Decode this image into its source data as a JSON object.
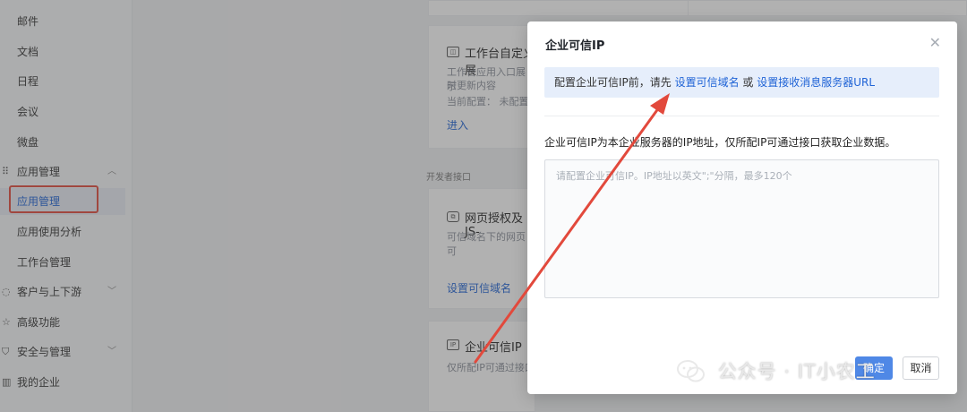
{
  "sidebar": {
    "items": [
      {
        "label": "邮件"
      },
      {
        "label": "文档"
      },
      {
        "label": "日程"
      },
      {
        "label": "会议"
      },
      {
        "label": "微盘"
      },
      {
        "label": "应用管理",
        "group": true,
        "icon": "grid-icon",
        "chevron": "up"
      },
      {
        "label": "应用管理",
        "active": true
      },
      {
        "label": "应用使用分析"
      },
      {
        "label": "工作台管理"
      },
      {
        "label": "客户与上下游",
        "group": true,
        "icon": "chat-icon",
        "chevron": "down"
      },
      {
        "label": "高级功能",
        "group": true,
        "icon": "star-icon"
      },
      {
        "label": "安全与管理",
        "group": true,
        "icon": "shield-icon",
        "chevron": "down"
      },
      {
        "label": "我的企业",
        "group": true,
        "icon": "building-icon"
      }
    ]
  },
  "background": {
    "card_workbench": {
      "title": "工作台自定义展",
      "desc_line1": "工作台应用入口展示",
      "desc_line2": "时更新内容",
      "config": "当前配置：  未配置",
      "link": "进入"
    },
    "section_label": "开发者接口",
    "card_web_auth": {
      "title": "网页授权及JS-",
      "desc": "可信域名下的网页可",
      "link": "设置可信域名"
    },
    "card_trusted_ip": {
      "icon_text": "IP",
      "title": "企业可信IP",
      "desc": "仅所配IP可通过接口"
    }
  },
  "modal": {
    "title": "企业可信IP",
    "close_icon": "close-icon",
    "notice_prefix": "配置企业可信IP前，请先 ",
    "notice_link1": "设置可信域名",
    "notice_mid": " 或 ",
    "notice_link2": "设置接收消息服务器URL",
    "description": "企业可信IP为本企业服务器的IP地址，仅所配IP可通过接口获取企业数据。",
    "ip_placeholder": "请配置企业可信IP。IP地址以英文\";\"分隔，最多120个",
    "ip_value": "",
    "ok_label": "确定",
    "cancel_label": "取消"
  },
  "watermark": {
    "text": "公众号 · IT小农工"
  },
  "colors": {
    "accent": "#1f63d6",
    "annotation_red": "#e2493c"
  }
}
